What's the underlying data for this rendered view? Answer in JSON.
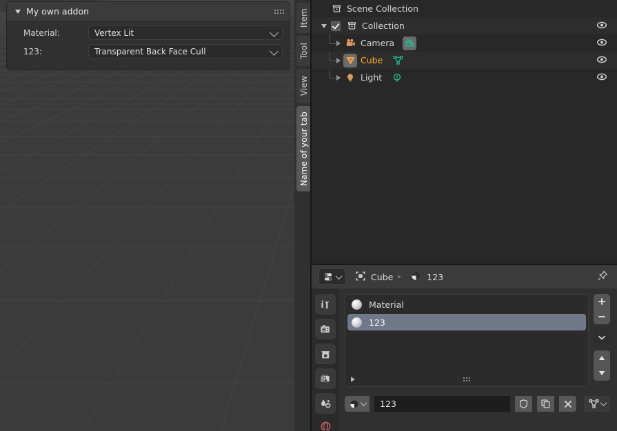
{
  "viewport": {
    "name": "3d-viewport",
    "background_color": "#3b3b3b",
    "grid_color": "#4a4a4a",
    "y_axis_color": "#6e9e24"
  },
  "npanel": {
    "header_title": "My own addon",
    "collapse_icon": "triangle-down-icon",
    "grip_icon": "grip-dots-icon",
    "rows": [
      {
        "label": "Material:",
        "value": "Vertex Lit",
        "icon": "chevron-down-icon"
      },
      {
        "label": "123:",
        "value": "Transparent Back Face Cull",
        "icon": "chevron-down-icon"
      }
    ]
  },
  "tabstrip": {
    "tabs": [
      {
        "label": "Item",
        "active": false
      },
      {
        "label": "Tool",
        "active": false
      },
      {
        "label": "View",
        "active": false
      },
      {
        "label": "Name of your tab",
        "active": true
      }
    ]
  },
  "outliner": {
    "rows": [
      {
        "name": "Scene Collection",
        "icon": "collection-icon",
        "indent": 0,
        "has_eye": false,
        "expander": "none",
        "active": false,
        "checkbox": false
      },
      {
        "name": "Collection",
        "icon": "collection-icon",
        "indent": 1,
        "has_eye": true,
        "expander": "down",
        "active": false,
        "checkbox": true
      },
      {
        "name": "Camera",
        "icon": "camera-object-icon",
        "data_icon": "camera-data-icon",
        "indent": 2,
        "has_eye": true,
        "expander": "right",
        "active": false,
        "checkbox": false
      },
      {
        "name": "Cube",
        "icon": "mesh-object-icon",
        "data_icon": "mesh-data-icon",
        "indent": 2,
        "has_eye": true,
        "expander": "right",
        "active": true,
        "checkbox": false
      },
      {
        "name": "Light",
        "icon": "light-object-icon",
        "data_icon": "light-data-icon",
        "indent": 2,
        "has_eye": true,
        "expander": "right",
        "active": false,
        "checkbox": false
      }
    ],
    "eye_icon": "eye-icon",
    "active_color": "#ffaf29"
  },
  "properties": {
    "header": {
      "editor_type_icon": "properties-editor-icon",
      "breadcrumb": [
        {
          "label": "Cube",
          "icon": "object-icon"
        },
        {
          "label": "123",
          "icon": "material-icon"
        }
      ],
      "pin_icon": "pin-icon"
    },
    "tabs": [
      {
        "name": "tool",
        "icon": "tool-icon"
      },
      {
        "name": "render",
        "icon": "render-icon"
      },
      {
        "name": "output",
        "icon": "output-printer-icon"
      },
      {
        "name": "view-layer",
        "icon": "view-layer-images-icon"
      },
      {
        "name": "scene",
        "icon": "scene-icon"
      },
      {
        "name": "world",
        "icon": "world-icon"
      }
    ],
    "material_slots": {
      "items": [
        {
          "label": "Material",
          "selected": false,
          "icon": "material-ball-icon"
        },
        {
          "label": "123",
          "selected": true,
          "icon": "material-ball-icon"
        }
      ],
      "buttons": [
        {
          "name": "add-slot",
          "glyph": "+"
        },
        {
          "name": "remove-slot",
          "glyph": "−"
        },
        {
          "name": "slot-specials",
          "glyph": "chevron-down-icon"
        },
        {
          "name": "move-slot-up",
          "glyph": "triangle-up-icon"
        },
        {
          "name": "move-slot-down",
          "glyph": "triangle-down-icon"
        }
      ],
      "filter_icon": "filter-expand-icon",
      "resize_grip_icon": "grip-dots-icon",
      "selected_color": "#71788a"
    },
    "material_name_row": {
      "browse_icon": "material-browse-icon",
      "name_value": "123",
      "fake_user_icon": "shield-icon",
      "duplicate_icon": "copy-icon",
      "unlink_icon": "close-x-icon",
      "mesh_data_icon": "mesh-data-icon"
    }
  }
}
